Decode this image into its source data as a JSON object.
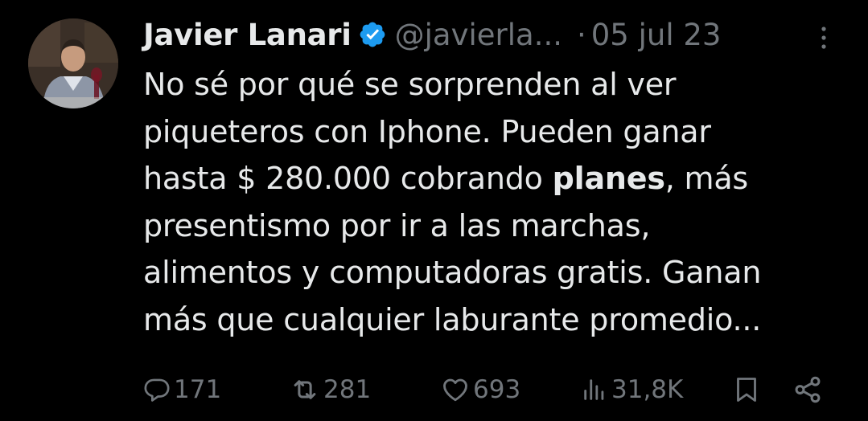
{
  "author": {
    "name": "Javier Lanari",
    "handle": "@javierla...",
    "verified": true,
    "verified_color": "#1d9bf0"
  },
  "meta": {
    "separator": "·",
    "date": "05 jul 23"
  },
  "tweet": {
    "lines": [
      "No sé por qué se sorprenden al ver",
      "piqueteros con Iphone. Pueden ganar",
      "hasta $ 280.000 cobrando ",
      "presentismo por ir a las marchas,",
      "alimentos y computadoras gratis. Ganan",
      "más que cualquier laburante promedio..."
    ],
    "bold_word": "planes",
    "after_bold": ", más"
  },
  "actions": {
    "replies": "171",
    "retweets": "281",
    "likes": "693",
    "views": "31,8K"
  },
  "icons": {
    "reply": "reply-icon",
    "retweet": "retweet-icon",
    "like": "heart-icon",
    "views": "views-icon",
    "bookmark": "bookmark-icon",
    "share": "share-icon",
    "more": "more-options-icon"
  },
  "colors": {
    "background": "#000000",
    "text": "#e7e9ea",
    "muted": "#71767b"
  }
}
